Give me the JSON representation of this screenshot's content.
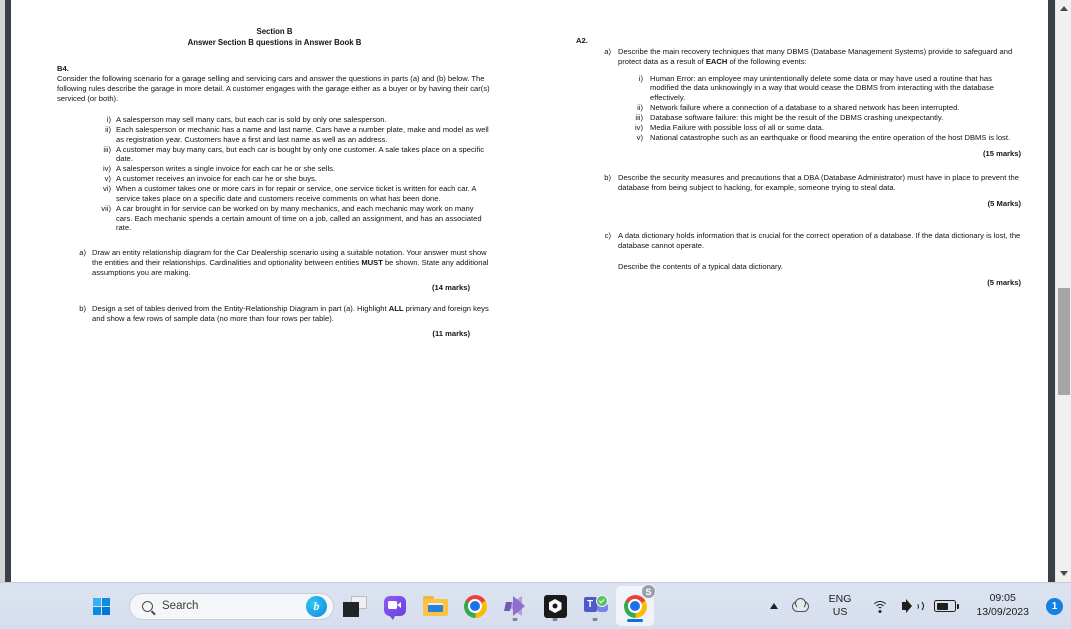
{
  "document": {
    "left_column": {
      "header_line1": "Section B",
      "header_line2": "Answer Section B questions in Answer Book B",
      "question_number": "B4.",
      "intro": "Consider the following scenario for a garage selling and servicing cars and answer the questions in parts (a) and (b) below. The following rules describe the garage in more detail. A customer engages with the garage either as a buyer or by having their car(s) serviced (or both).",
      "rules": [
        {
          "marker": "i)",
          "text": "A salesperson may sell many cars, but each car is sold by only one salesperson."
        },
        {
          "marker": "ii)",
          "text": "Each salesperson or mechanic has a name and last name. Cars have a number plate, make and model as well as registration year. Customers have a first and last name as well as an address."
        },
        {
          "marker": "iii)",
          "text": "A customer may buy many cars, but each car is bought by only one customer. A sale takes place on a specific date."
        },
        {
          "marker": "iv)",
          "text": "A salesperson writes a single invoice for each car he or she sells."
        },
        {
          "marker": "v)",
          "text": "A customer receives an invoice for each car he or she buys."
        },
        {
          "marker": "vi)",
          "text": "When a customer takes one or more cars in for repair or service, one service ticket is written for each car. A service takes place on a specific date and customers receive comments on what has been done."
        },
        {
          "marker": "vii)",
          "text": "A car brought in for service can be worked on by many mechanics, and each mechanic may work on many cars. Each mechanic spends a certain amount of time on a job, called an assignment, and has an associated rate."
        }
      ],
      "part_a": {
        "marker": "a)",
        "text_before_bold": "Draw an entity relationship diagram for the Car Dealership scenario using a suitable notation. Your answer must show the entities and their relationships. Cardinalities and optionality between entities ",
        "bold_word": "MUST",
        "text_after_bold": " be shown. State any additional assumptions you are making.",
        "marks": "(14 marks)"
      },
      "part_b": {
        "marker": "b)",
        "text_before_bold": "Design a set of tables derived from the Entity-Relationship Diagram in part (a). Highlight ",
        "bold_word": "ALL",
        "text_after_bold": " primary and foreign keys and show a few rows of sample data (no more than four rows per table).",
        "marks": "(11 marks)"
      }
    },
    "right_column": {
      "question_number": "A2.",
      "part_a": {
        "marker": "a)",
        "text_before_bold": "Describe the main recovery techniques that many DBMS (Database Management Systems) provide to safeguard and protect data as a result of ",
        "bold_word": "EACH",
        "text_after_bold": " of the following events:",
        "events": [
          {
            "marker": "i)",
            "text": "Human Error: an employee may unintentionally delete some data or may have used a routine that has modified the data unknowingly in a way that would cease the DBMS from interacting with the database effectively."
          },
          {
            "marker": "ii)",
            "text": "Network failure where a connection of a database to a shared network has been interrupted."
          },
          {
            "marker": "iii)",
            "text": "Database software failure: this might be the result of the DBMS crashing unexpectantly."
          },
          {
            "marker": "iv)",
            "text": "Media Failure with possible loss of all or some data."
          },
          {
            "marker": "v)",
            "text": "National catastrophe such as an earthquake or flood meaning the entire operation of the host DBMS is lost."
          }
        ],
        "marks": "(15 marks)"
      },
      "part_b": {
        "marker": "b)",
        "text": "Describe the security measures and precautions that a DBA (Database Administrator) must have in place to prevent the database from being subject to hacking, for example, someone trying to steal data.",
        "marks": "(5 Marks)"
      },
      "part_c": {
        "marker": "c)",
        "text": "A data dictionary holds information that is crucial for the correct operation of a database. If the data dictionary is lost, the database cannot operate.",
        "text2": "Describe the contents of a typical data dictionary.",
        "marks": "(5 marks)"
      }
    }
  },
  "scrollbar": {
    "up_arrow": "scroll-up",
    "down_arrow": "scroll-down"
  },
  "taskbar": {
    "start_label": "Start",
    "search": {
      "placeholder": "Search",
      "value": "Search",
      "assistant_glyph": "b"
    },
    "apps": [
      {
        "name": "task-view",
        "label": "Task View"
      },
      {
        "name": "chat",
        "label": "Chat"
      },
      {
        "name": "file-explorer",
        "label": "File Explorer"
      },
      {
        "name": "google-chrome",
        "label": "Google Chrome"
      },
      {
        "name": "visual-studio",
        "label": "Visual Studio"
      },
      {
        "name": "unity",
        "label": "Unity"
      },
      {
        "name": "microsoft-teams",
        "label": "Microsoft Teams"
      },
      {
        "name": "chrome-window",
        "label": "Google Chrome",
        "badge": "S"
      }
    ],
    "tray": {
      "overflow": "show-hidden-icons",
      "onedrive": "OneDrive",
      "language_line1": "ENG",
      "language_line2": "US",
      "wifi": "wifi-icon",
      "volume": "volume-icon",
      "battery": "battery-icon",
      "time": "09:05",
      "date": "13/09/2023",
      "notification_count": "1"
    }
  },
  "colors": {
    "accent": "#1480e0",
    "taskbar_bg": "#dce3f0",
    "page_bg": "#ffffff",
    "band": "#3b4046"
  }
}
